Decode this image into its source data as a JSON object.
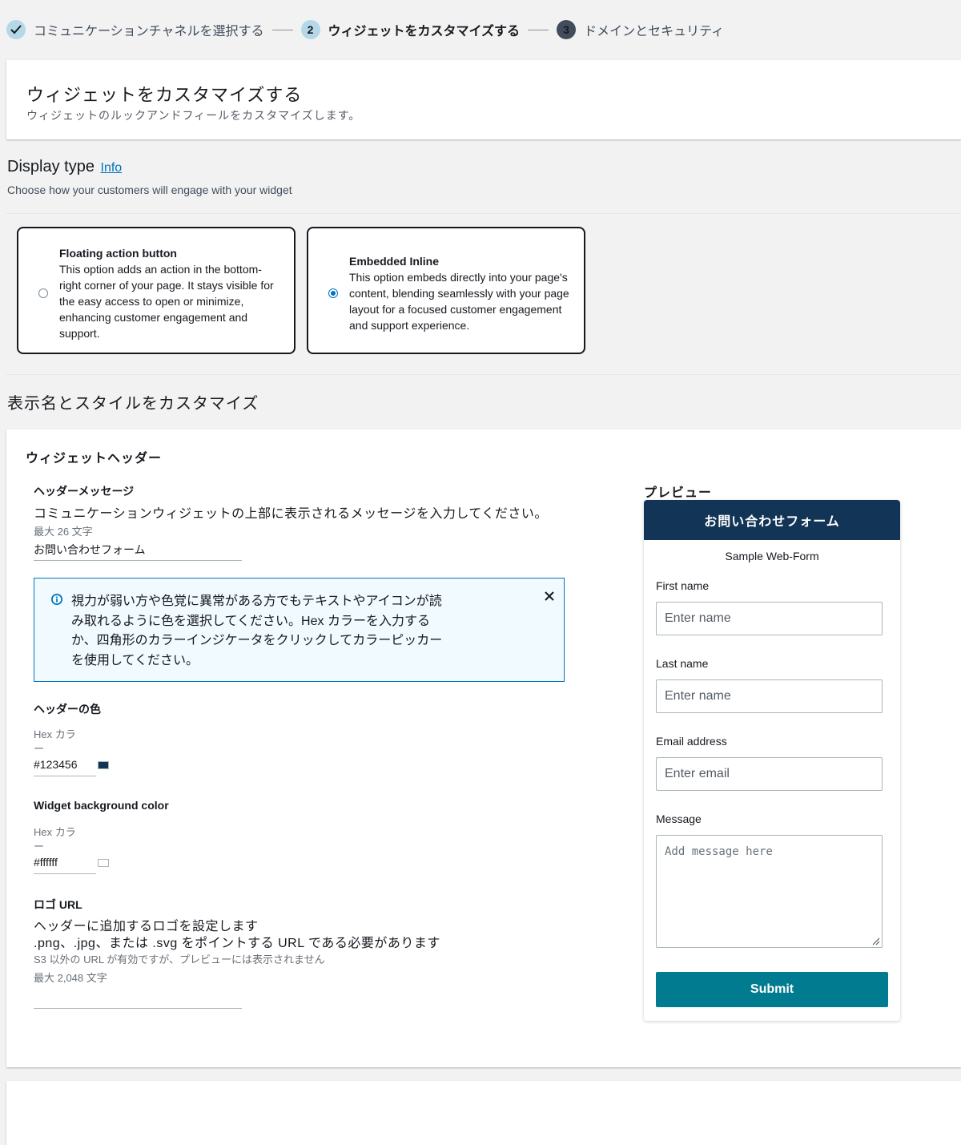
{
  "stepper": {
    "steps": [
      {
        "label": "コミュニケーションチャネルを選択する",
        "state": "done",
        "number": ""
      },
      {
        "label": "ウィジェットをカスタマイズする",
        "state": "active",
        "number": "2"
      },
      {
        "label": "ドメインとセキュリティ",
        "state": "future",
        "number": "3"
      }
    ]
  },
  "page_header": {
    "title": "ウィジェットをカスタマイズする",
    "subtitle": "ウィジェットのルックアンドフィールをカスタマイズします。"
  },
  "display_type": {
    "title": "Display type",
    "info_link": "Info",
    "subtitle": "Choose how your customers will engage with your widget",
    "options": [
      {
        "title": "Floating action button",
        "description": "This option adds an action in the bottom-right corner of your page. It stays visible for the easy access to open or minimize, enhancing customer engagement and support.",
        "selected": false
      },
      {
        "title": "Embedded Inline",
        "description": "This option embeds directly into your page's content, blending seamlessly with your page layout for a focused customer engagement and support experience.",
        "selected": true
      }
    ]
  },
  "style_section": {
    "title": "表示名とスタイルをカスタマイズ",
    "widget_header_title": "ウィジェットヘッダー",
    "header_message": {
      "label": "ヘッダーメッセージ",
      "description": "コミュニケーションウィジェットの上部に表示されるメッセージを入力してください。",
      "constraint": "最大 26 文字",
      "value": "お問い合わせフォーム"
    },
    "info_alert": {
      "text": "視力が弱い方や色覚に異常がある方でもテキストやアイコンが読み取れるように色を選択してください。Hex カラーを入力するか、四角形のカラーインジケータをクリックしてカラーピッカーを使用してください。"
    },
    "header_color": {
      "label": "ヘッダーの色",
      "hex_label": "Hex カラ",
      "hex_label_2": "ー",
      "value": "#123456",
      "swatch": "#123456"
    },
    "bg_color": {
      "label": "Widget background color",
      "hex_label": "Hex カラ",
      "hex_label_2": "ー",
      "value": "#ffffff",
      "swatch": "#ffffff"
    },
    "logo_url": {
      "label": "ロゴ URL",
      "description_1": "ヘッダーに追加するロゴを設定します",
      "description_2": ".png、.jpg、または .svg をポイントする URL である必要があります",
      "hint_1": "S3 以外の URL が有効ですが、プレビューには表示されません",
      "hint_2": "最大 2,048 文字",
      "value": ""
    }
  },
  "preview": {
    "label": "プレビュー",
    "header_text": "お問い合わせフォーム",
    "header_color": "#123456",
    "form_title": "Sample Web-Form",
    "fields": [
      {
        "label": "First name",
        "placeholder": "Enter name"
      },
      {
        "label": "Last name",
        "placeholder": "Enter name"
      },
      {
        "label": "Email address",
        "placeholder": "Enter email"
      }
    ],
    "message": {
      "label": "Message",
      "placeholder": "Add message here"
    },
    "submit_label": "Submit",
    "submit_color": "#007b8f"
  },
  "icons": {
    "check": "check-icon",
    "info": "info-circle-icon",
    "close": "close-icon",
    "resize": "resize-handle-icon"
  }
}
